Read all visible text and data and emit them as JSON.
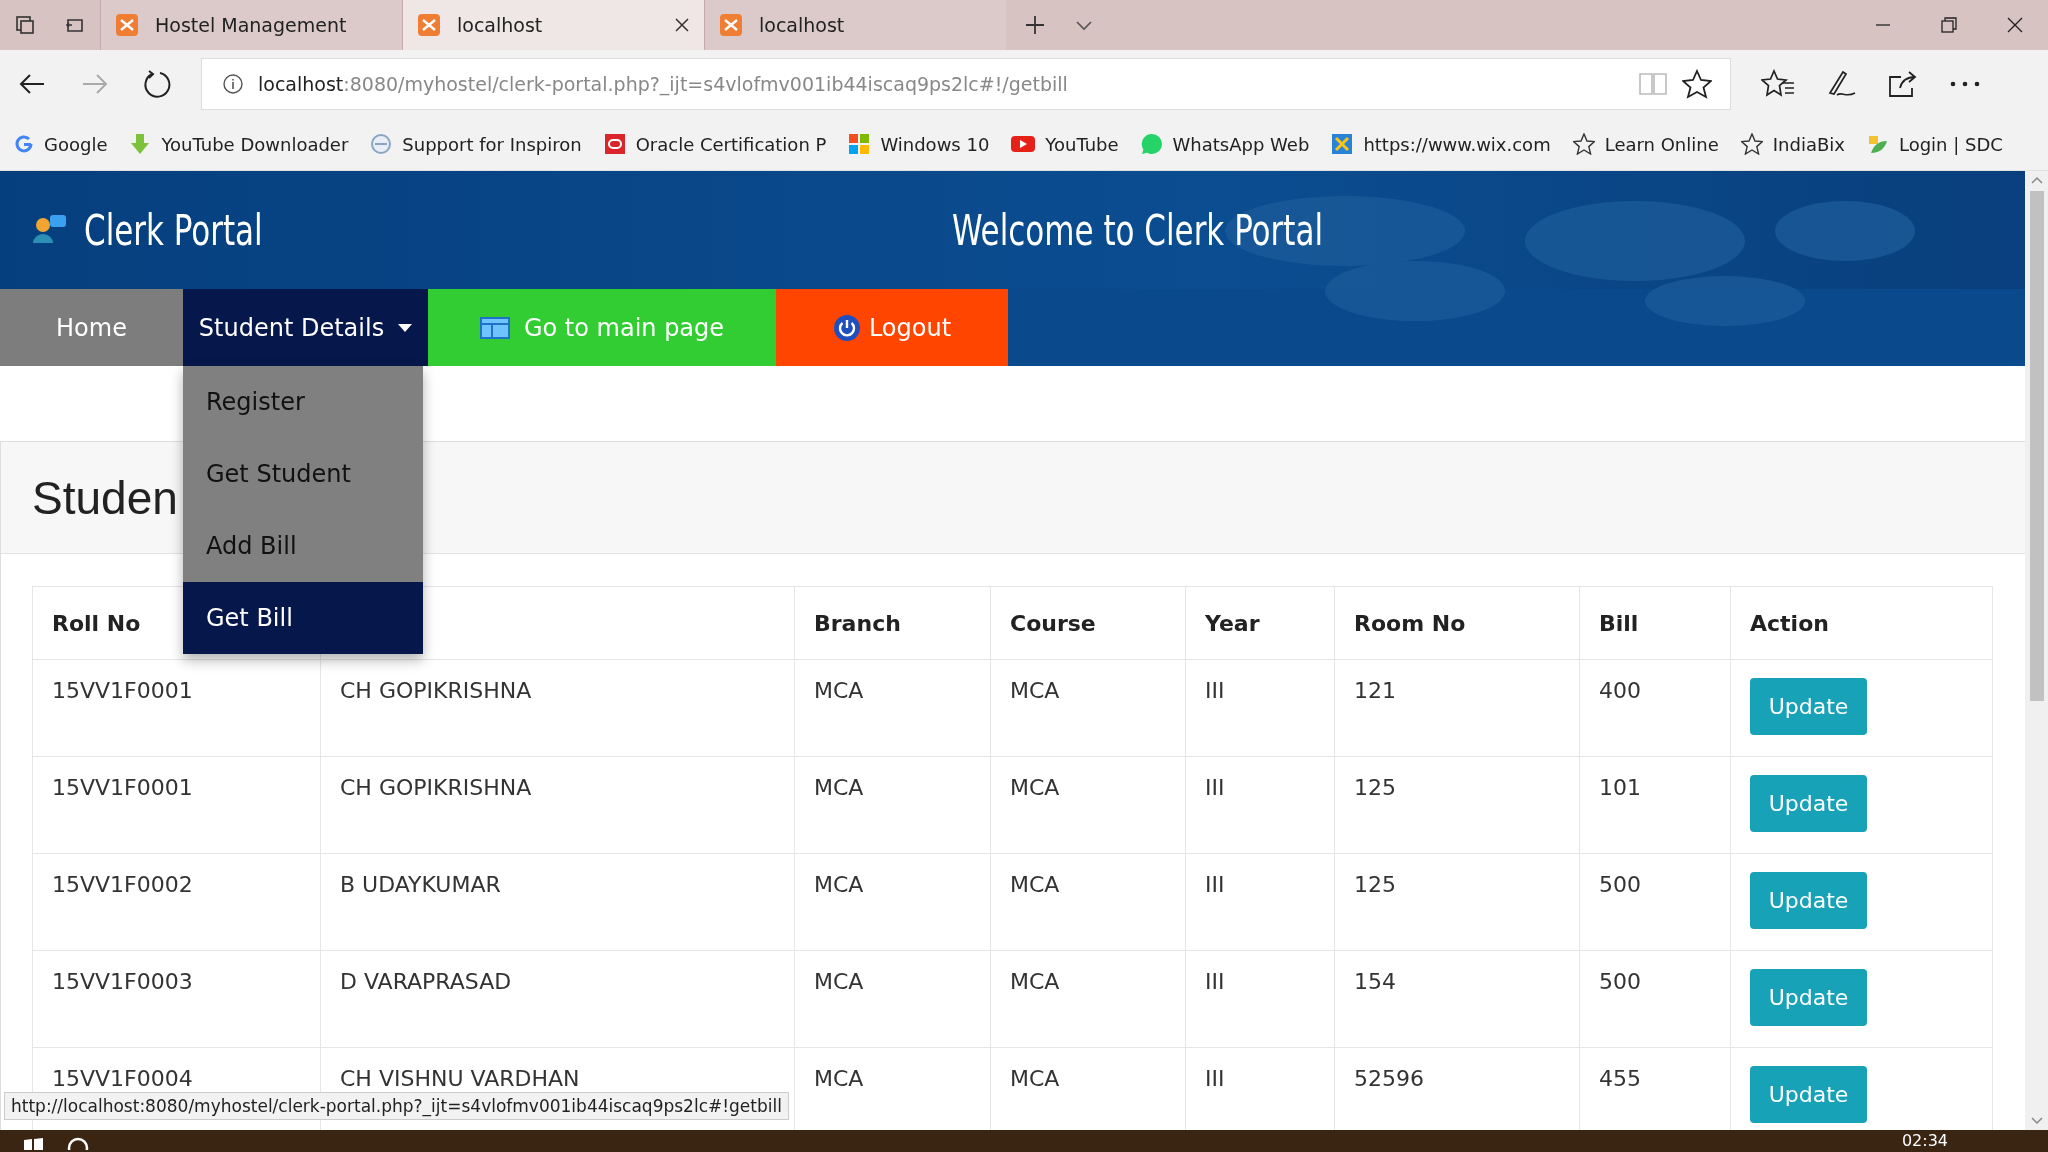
{
  "browser": {
    "tabs": [
      {
        "title": "Hostel Management",
        "selected": false,
        "closable": false
      },
      {
        "title": "localhost",
        "selected": true,
        "closable": true
      },
      {
        "title": "localhost",
        "selected": false,
        "closable": false
      }
    ],
    "address": {
      "host": "localhost",
      "rest": ":8080/myhostel/clerk-portal.php?_ijt=s4vlofmv001ib44iscaq9ps2lc#!/getbill"
    },
    "bookmarks": [
      {
        "label": "Google",
        "kind": "google"
      },
      {
        "label": "YouTube Downloader",
        "kind": "download"
      },
      {
        "label": "Support for Inspiron",
        "kind": "circle"
      },
      {
        "label": "Oracle Certification P",
        "kind": "oracle"
      },
      {
        "label": "Windows 10",
        "kind": "windows"
      },
      {
        "label": "YouTube",
        "kind": "youtube"
      },
      {
        "label": "WhatsApp Web",
        "kind": "whatsapp"
      },
      {
        "label": "https://www.wix.com",
        "kind": "wix"
      },
      {
        "label": "Learn Online",
        "kind": "star"
      },
      {
        "label": "IndiaBix",
        "kind": "star"
      },
      {
        "label": "Login | SDC",
        "kind": "leaf"
      }
    ],
    "status_url": "http://localhost:8080/myhostel/clerk-portal.php?_ijt=s4vlofmv001ib44iscaq9ps2lc#!getbill"
  },
  "page": {
    "brand": "Clerk Portal",
    "welcome": "Welcome to Clerk Portal",
    "nav": [
      {
        "label": "Home",
        "kind": "home"
      },
      {
        "label": "Student Details",
        "kind": "dropdown",
        "expanded": true
      },
      {
        "label": "Go to main page",
        "kind": "main"
      },
      {
        "label": "Logout",
        "kind": "logout"
      }
    ],
    "dropdown": [
      {
        "label": "Register",
        "selected": false
      },
      {
        "label": "Get Student",
        "selected": false
      },
      {
        "label": "Add Bill",
        "selected": false
      },
      {
        "label": "Get Bill",
        "selected": true
      }
    ],
    "heading": "Studen",
    "table": {
      "columns": [
        "Roll No",
        "",
        "Branch",
        "Course",
        "Year",
        "Room No",
        "Bill",
        "Action"
      ],
      "rows": [
        {
          "roll": "15VV1F0001",
          "name": "CH GOPIKRISHNA",
          "branch": "MCA",
          "course": "MCA",
          "year": "III",
          "room": "121",
          "bill": "400",
          "action": "Update"
        },
        {
          "roll": "15VV1F0001",
          "name": "CH GOPIKRISHNA",
          "branch": "MCA",
          "course": "MCA",
          "year": "III",
          "room": "125",
          "bill": "101",
          "action": "Update"
        },
        {
          "roll": "15VV1F0002",
          "name": "B UDAYKUMAR",
          "branch": "MCA",
          "course": "MCA",
          "year": "III",
          "room": "125",
          "bill": "500",
          "action": "Update"
        },
        {
          "roll": "15VV1F0003",
          "name": "D VARAPRASAD",
          "branch": "MCA",
          "course": "MCA",
          "year": "III",
          "room": "154",
          "bill": "500",
          "action": "Update"
        },
        {
          "roll": "15VV1F0004",
          "name": "CH VISHNU VARDHAN",
          "branch": "MCA",
          "course": "MCA",
          "year": "III",
          "room": "52596",
          "bill": "455",
          "action": "Update"
        }
      ]
    }
  },
  "taskbar": {
    "time": "02:34"
  }
}
